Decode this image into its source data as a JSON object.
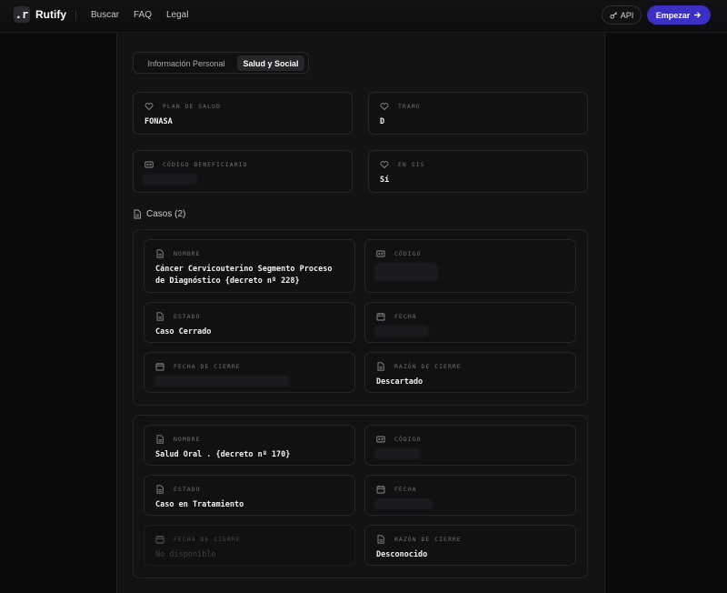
{
  "header": {
    "logo_mark": ".r",
    "logo_text": "Rutify",
    "nav": [
      "Buscar",
      "FAQ",
      "Legal"
    ],
    "api_label": "API",
    "start_label": "Empezar",
    "accent": "#3c2fc4"
  },
  "tabs": [
    {
      "label": "Información Personal",
      "active": false
    },
    {
      "label": "Salud y Social",
      "active": true
    }
  ],
  "health": {
    "plan": {
      "label": "PLAN DE SALUD",
      "value": "FONASA",
      "icon": "heart-icon"
    },
    "tramo": {
      "label": "TRAMO",
      "value": "D",
      "icon": "heart-icon"
    },
    "codigo": {
      "label": "CÓDIGO BENEFICIARIO",
      "value": "",
      "icon": "id-card-icon"
    },
    "sis": {
      "label": "EN SIS",
      "value": "Sí",
      "icon": "heart-icon"
    }
  },
  "cases_title": "Casos (2)",
  "cases": [
    {
      "nombre_label": "NOMBRE",
      "nombre": "Cáncer Cervicouterino Segmento Proceso de Diagnóstico {decreto nº 228}",
      "codigo_label": "CÓDIGO",
      "estado_label": "ESTADO",
      "estado": "Caso Cerrado",
      "fecha_label": "FECHA",
      "cierre_label": "FECHA DE CIERRE",
      "razon_label": "RAZÓN DE CIERRE",
      "razon": "Descartado"
    },
    {
      "nombre_label": "NOMBRE",
      "nombre": "Salud Oral . {decreto nº 170}",
      "codigo_label": "CÓDIGO",
      "estado_label": "ESTADO",
      "estado": "Caso en Tratamiento",
      "fecha_label": "FECHA",
      "cierre_label": "FECHA DE CIERRE",
      "cierre": "No disponible",
      "razon_label": "RAZÓN DE CIERRE",
      "razon": "Desconocido"
    }
  ]
}
